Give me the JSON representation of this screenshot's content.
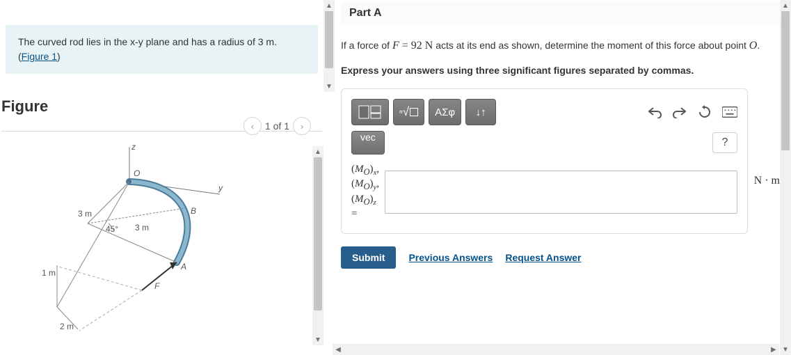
{
  "problem": {
    "text_pre": "The curved rod lies in the x-y plane and has a radius of ",
    "radius": "3 m",
    "text_post": ". (",
    "figure_link": "Figure 1",
    "text_end": ")"
  },
  "figure": {
    "heading": "Figure",
    "pager": "1 of 1",
    "labels": {
      "z": "z",
      "y": "y",
      "O": "O",
      "B": "B",
      "A": "A",
      "F": "F",
      "r1": "3 m",
      "r2": "3 m",
      "ang": "45°",
      "d1": "1 m",
      "d2": "2 m"
    }
  },
  "partA": {
    "title": "Part A",
    "q1": "If a force of ",
    "F": "F",
    "eq": " = 92 ",
    "N": "N",
    "q2": " acts at its end as shown, determine the moment of this force about point ",
    "O": "O",
    "period": ".",
    "instruction": "Express your answers using three significant figures separated by commas.",
    "toolbar": {
      "template": "template-icon",
      "sqrt": "√☐",
      "greek": "ΑΣφ",
      "updown": "↓↑",
      "undo": "↶",
      "redo": "↷",
      "reset": "⟳",
      "keyboard": "⌨",
      "vec": "vec",
      "help": "?"
    },
    "labels": {
      "Mox": "(M_O)_x,",
      "Moy": "(M_O)_y,",
      "Moz": "(M_O)_z",
      "eq": "="
    },
    "unit": "N · m",
    "submit": "Submit",
    "prev": "Previous Answers",
    "request": "Request Answer"
  }
}
